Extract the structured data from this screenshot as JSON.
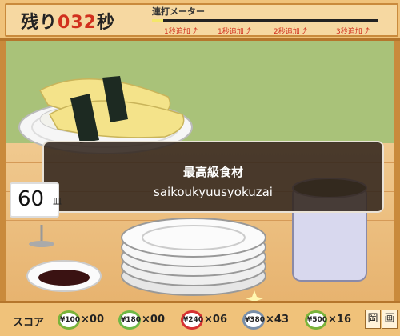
{
  "timer": {
    "prefix": "残り",
    "value": "032",
    "suffix": "秒"
  },
  "meter": {
    "title": "連打メーター",
    "progress": 0.05,
    "marks": [
      "1秒追加",
      "1秒追加",
      "2秒追加",
      "3秒追加"
    ]
  },
  "prompt": {
    "japanese": "最高級食材",
    "romaji": "saikoukyuusyokuzai"
  },
  "plate_counter": {
    "count": "60",
    "unit": "皿"
  },
  "score": {
    "label": "スコア",
    "plates": [
      {
        "price": "¥100",
        "count": "×00",
        "color": "#7ab33a"
      },
      {
        "price": "¥180",
        "count": "×00",
        "color": "#6fb845"
      },
      {
        "price": "¥240",
        "count": "×06",
        "color": "#d63232"
      },
      {
        "price": "¥380",
        "count": "×43",
        "color": "#7a8fa8"
      },
      {
        "price": "¥500",
        "count": "×16",
        "color": "#7ab33a"
      }
    ]
  },
  "buttons": {
    "left": "岡",
    "right": "画"
  },
  "colors": {
    "background": "#f0c27a",
    "accent_red": "#d1301d",
    "wall": "#a9c279"
  }
}
